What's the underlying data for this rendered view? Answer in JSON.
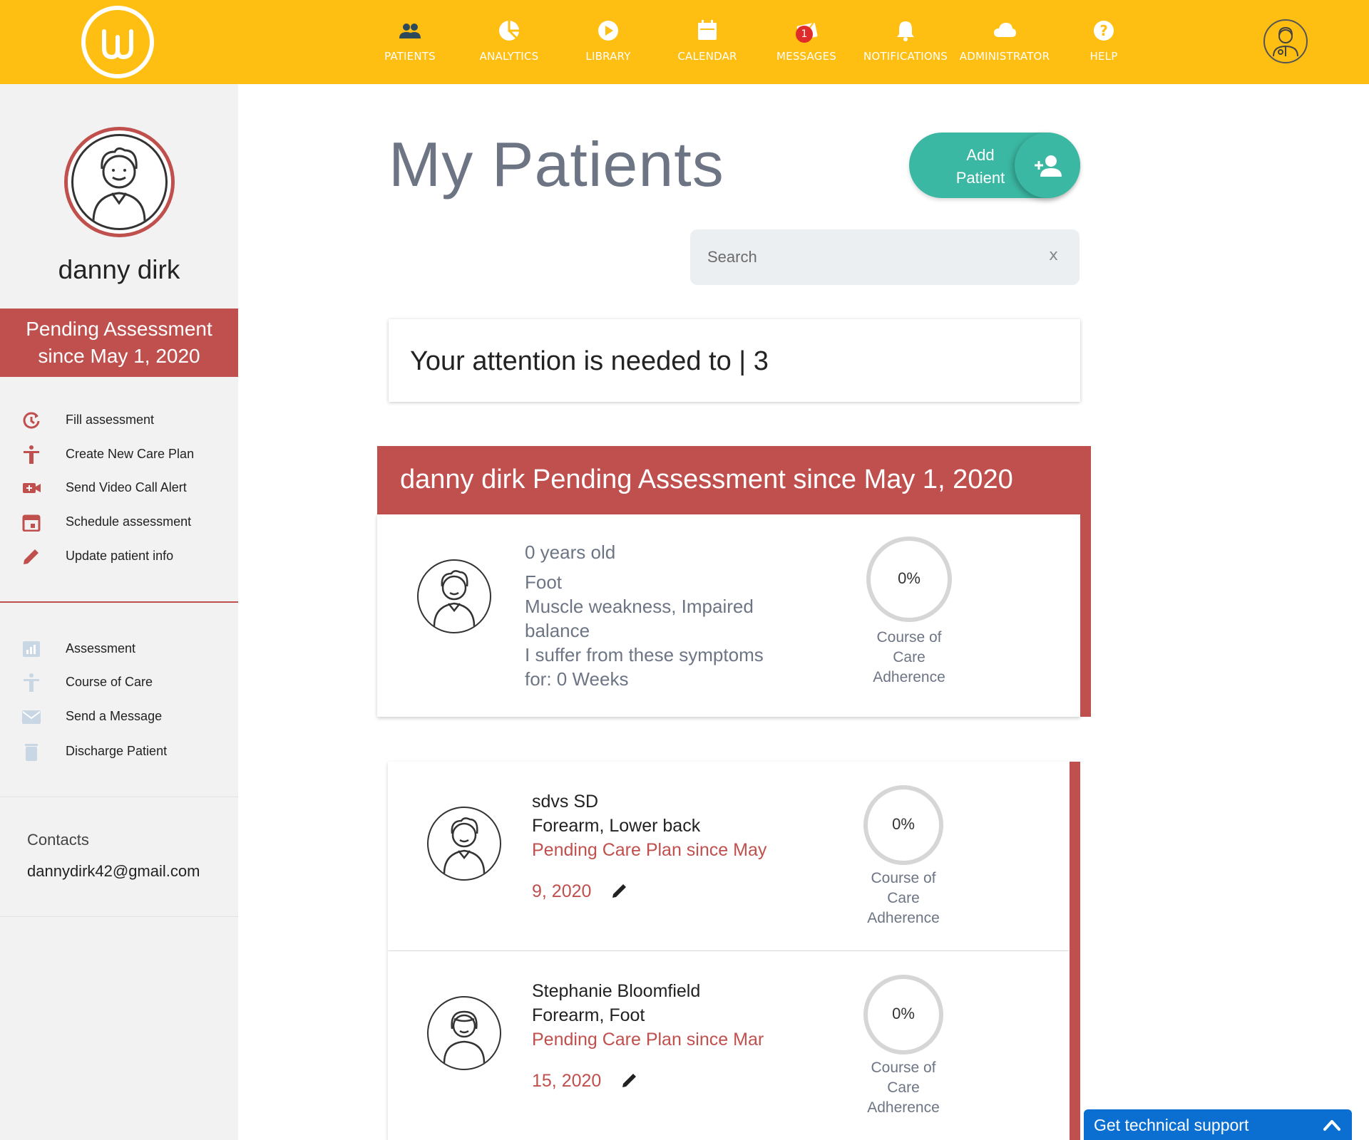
{
  "app": {
    "nav": [
      {
        "label": "PATIENTS",
        "icon": "patients-icon"
      },
      {
        "label": "ANALYTICS",
        "icon": "analytics-icon"
      },
      {
        "label": "LIBRARY",
        "icon": "library-icon"
      },
      {
        "label": "CALENDAR",
        "icon": "calendar-icon"
      },
      {
        "label": "MESSAGES",
        "icon": "messages-icon",
        "badge": "1"
      },
      {
        "label": "NOTIFICATIONS",
        "icon": "notifications-icon"
      },
      {
        "label": "ADMINISTRATOR",
        "icon": "cloud-icon"
      },
      {
        "label": "HELP",
        "icon": "help-icon"
      }
    ],
    "colors": {
      "topbar": "#FFBE12",
      "accent": "#C0504D",
      "teal": "#3BB8A3",
      "support": "#0A6FD1"
    }
  },
  "sidebar": {
    "name": "danny dirk",
    "status_line1": "Pending Assessment",
    "status_line2": "since May 1, 2020",
    "actions": [
      {
        "label": "Fill assessment",
        "icon": "assessment-clock-icon"
      },
      {
        "label": "Create New Care Plan",
        "icon": "person-icon"
      },
      {
        "label": "Send Video Call Alert",
        "icon": "video-call-icon"
      },
      {
        "label": "Schedule assessment",
        "icon": "calendar-icon"
      },
      {
        "label": "Update patient info",
        "icon": "pencil-icon"
      }
    ],
    "secondary": [
      {
        "label": "Assessment",
        "icon": "bar-chart-icon"
      },
      {
        "label": "Course of Care",
        "icon": "person-icon"
      },
      {
        "label": "Send a Message",
        "icon": "mail-icon"
      },
      {
        "label": "Discharge Patient",
        "icon": "trash-icon"
      }
    ],
    "contacts_label": "Contacts",
    "contacts_email": "dannydirk42@gmail.com"
  },
  "main": {
    "title": "My Patients",
    "add_patient_line1": "Add",
    "add_patient_line2": "Patient",
    "search_placeholder": "Search",
    "search_clear": "x",
    "attention_text": "Your attention is needed to | 3",
    "featured": {
      "header": "danny dirk Pending Assessment since May 1, 2020",
      "age": "0 years old",
      "area": "Foot",
      "conditions_line1": "Muscle weakness, Impaired",
      "conditions_line2": "balance",
      "symptoms_line1": "I suffer from these symptoms",
      "symptoms_line2": "for: 0 Weeks",
      "percent": "0%",
      "adherence_line1": "Course of",
      "adherence_line2": "Care",
      "adherence_line3": "Adherence"
    },
    "patients": [
      {
        "name": "sdvs SD",
        "areas": "Forearm, Lower back",
        "status_line1": "Pending Care Plan since May",
        "status_line2": "9, 2020",
        "percent": "0%",
        "adherence_line1": "Course of",
        "adherence_line2": "Care",
        "adherence_line3": "Adherence"
      },
      {
        "name": "Stephanie Bloomfield",
        "areas": "Forearm, Foot",
        "status_line1": "Pending Care Plan since Mar",
        "status_line2": "15, 2020",
        "percent": "0%",
        "adherence_line1": "Course of",
        "adherence_line2": "Care",
        "adherence_line3": "Adherence"
      }
    ],
    "support_label": "Get technical support"
  }
}
